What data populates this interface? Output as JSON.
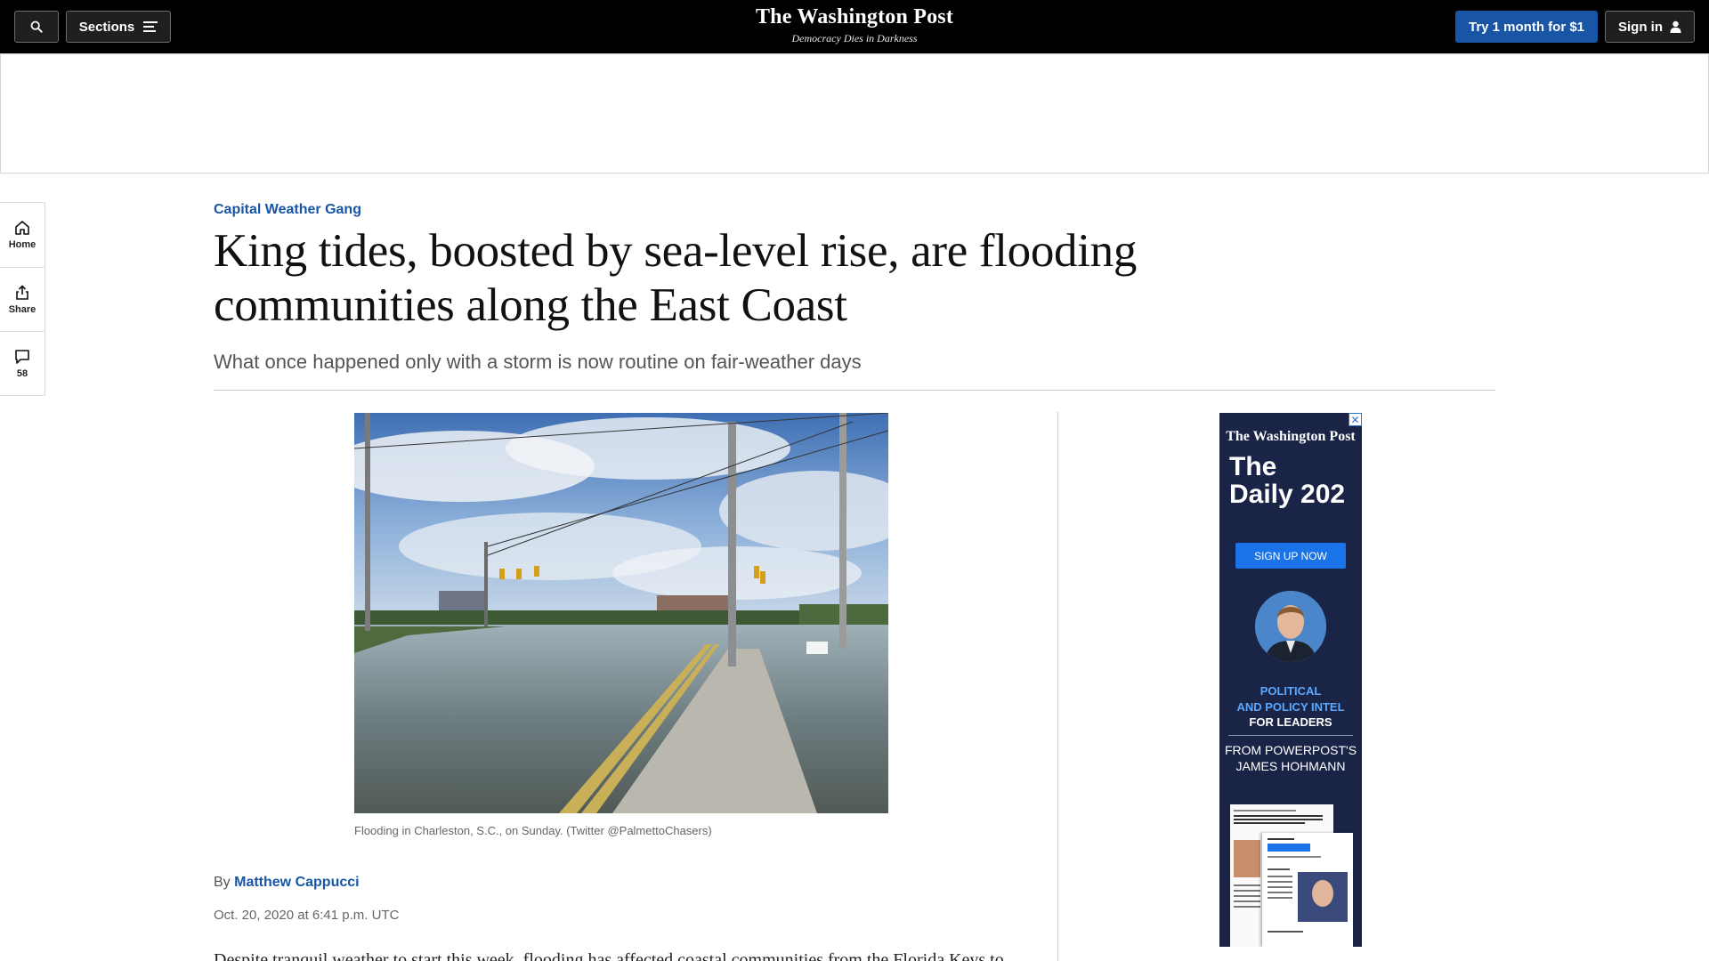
{
  "header": {
    "sections_label": "Sections",
    "logo": "The Washington Post",
    "tagline": "Democracy Dies in Darkness",
    "try_label": "Try 1 month for $1",
    "signin_label": "Sign in",
    "icons": [
      "search-icon",
      "menu-icon",
      "user-icon"
    ]
  },
  "rail": {
    "home": "Home",
    "share": "Share",
    "comments": "58",
    "icons": [
      "home-icon",
      "share-icon",
      "comment-icon"
    ]
  },
  "article": {
    "kicker": "Capital Weather Gang",
    "headline": "King tides, boosted by sea-level rise, are flooding communities along the East Coast",
    "dek": "What once happened only with a storm is now routine on fair-weather days",
    "caption": "Flooding in Charleston, S.C., on Sunday. (Twitter @PalmettoChasers)",
    "byline_prefix": "By",
    "author": "Matthew Cappucci",
    "date": "Oct. 20, 2020 at 6:41 p.m. UTC",
    "body_start": "Despite tranquil weather to start this week, flooding has affected coastal communities from the Florida Keys to"
  },
  "ad": {
    "close": "✕",
    "logo": "The Washington Post",
    "title_line1": "The",
    "title_line2": "Daily 202",
    "cta": "SIGN UP NOW",
    "tag_line1": "POLITICAL",
    "tag_line2": "AND POLICY INTEL",
    "tag_line3": "FOR LEADERS",
    "from_line1": "FROM POWERPOST'S",
    "from_line2": "JAMES HOHMANN"
  },
  "colors": {
    "accent": "#1955a5",
    "topbar": "#000000",
    "ad_bg": "#1a2446"
  }
}
